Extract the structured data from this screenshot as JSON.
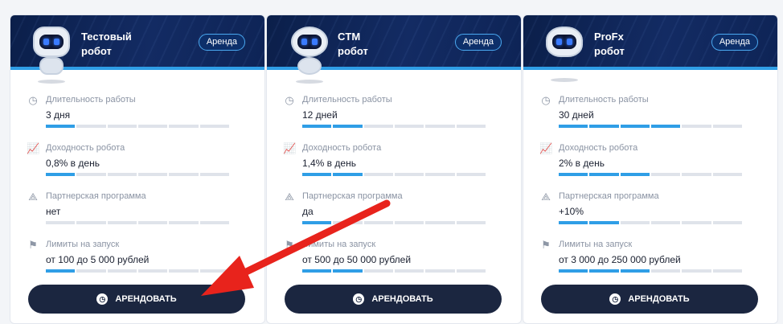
{
  "cards": [
    {
      "title_line1": "Тестовый",
      "title_line2": "робот",
      "badge": "Аренда",
      "stats": [
        {
          "icon": "clock-icon",
          "label": "Длительность работы",
          "value": "3 дня",
          "level_filled": 1,
          "level_total": 6
        },
        {
          "icon": "chart-growth-icon",
          "label": "Доходность робота",
          "value": "0,8% в день",
          "level_filled": 1,
          "level_total": 6
        },
        {
          "icon": "affiliate-network-icon",
          "label": "Партнерская программа",
          "value": "нет",
          "level_filled": 0,
          "level_total": 6
        },
        {
          "icon": "rocket-launch-icon",
          "label": "Лимиты на запуск",
          "value": "от 100 до 5 000 рублей",
          "level_filled": 1,
          "level_total": 6
        }
      ],
      "button": "АРЕНДОВАТЬ"
    },
    {
      "title_line1": "CTM",
      "title_line2": "робот",
      "badge": "Аренда",
      "stats": [
        {
          "icon": "clock-icon",
          "label": "Длительность работы",
          "value": "12 дней",
          "level_filled": 2,
          "level_total": 6
        },
        {
          "icon": "chart-growth-icon",
          "label": "Доходность робота",
          "value": "1,4% в день",
          "level_filled": 2,
          "level_total": 6
        },
        {
          "icon": "affiliate-network-icon",
          "label": "Партнерская программа",
          "value": "да",
          "level_filled": 1,
          "level_total": 6
        },
        {
          "icon": "rocket-launch-icon",
          "label": "Лимиты на запуск",
          "value": "от 500 до 50 000 рублей",
          "level_filled": 2,
          "level_total": 6
        }
      ],
      "button": "АРЕНДОВАТЬ"
    },
    {
      "title_line1": "ProFx",
      "title_line2": "робот",
      "badge": "Аренда",
      "stats": [
        {
          "icon": "clock-icon",
          "label": "Длительность работы",
          "value": "30 дней",
          "level_filled": 4,
          "level_total": 6
        },
        {
          "icon": "chart-growth-icon",
          "label": "Доходность робота",
          "value": "2% в день",
          "level_filled": 3,
          "level_total": 6
        },
        {
          "icon": "affiliate-network-icon",
          "label": "Партнерская программа",
          "value": "+10%",
          "level_filled": 2,
          "level_total": 6
        },
        {
          "icon": "rocket-launch-icon",
          "label": "Лимиты на запуск",
          "value": "от 3 000 до 250 000 рублей",
          "level_filled": 3,
          "level_total": 6
        }
      ],
      "button": "АРЕНДОВАТЬ"
    }
  ],
  "colors": {
    "header_bg": "#0b1f4a",
    "accent": "#2f9ee6",
    "button_bg": "#1b2640",
    "annotation_arrow": "#e8231c"
  }
}
